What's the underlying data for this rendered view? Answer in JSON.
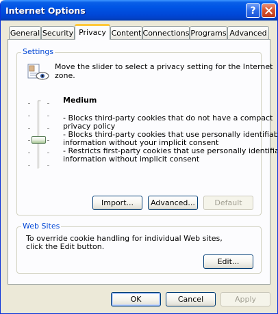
{
  "window": {
    "title": "Internet Options",
    "help_glyph": "?",
    "close_glyph": "✕"
  },
  "tabs": [
    {
      "label": "General",
      "selected": false
    },
    {
      "label": "Security",
      "selected": false
    },
    {
      "label": "Privacy",
      "selected": true
    },
    {
      "label": "Content",
      "selected": false
    },
    {
      "label": "Connections",
      "selected": false
    },
    {
      "label": "Programs",
      "selected": false
    },
    {
      "label": "Advanced",
      "selected": false
    }
  ],
  "settings": {
    "label": "Settings",
    "description_line1": "Move the slider to select a privacy setting for the Internet",
    "description_line2": "zone.",
    "level_name": "Medium",
    "slider_level": "Medium",
    "details": [
      "- Blocks third-party cookies that do not have a compact",
      "privacy policy",
      "- Blocks third-party cookies that use personally identifiable",
      "information without your implicit consent",
      "- Restricts first-party cookies that use personally identifiable",
      "information without implicit consent"
    ],
    "import_label": "Import...",
    "advanced_label": "Advanced...",
    "default_label": "Default"
  },
  "websites": {
    "label": "Web Sites",
    "text_line1": "To override cookie handling for individual Web sites,",
    "text_line2": "click the Edit button.",
    "edit_label": "Edit..."
  },
  "footer": {
    "ok_label": "OK",
    "cancel_label": "Cancel",
    "apply_label": "Apply"
  },
  "colors": {
    "titlebar_blue": "#0055e5",
    "dialog_bg": "#ece9d8",
    "group_label": "#0046d5",
    "selected_tab_accent": "#ffc83c"
  }
}
